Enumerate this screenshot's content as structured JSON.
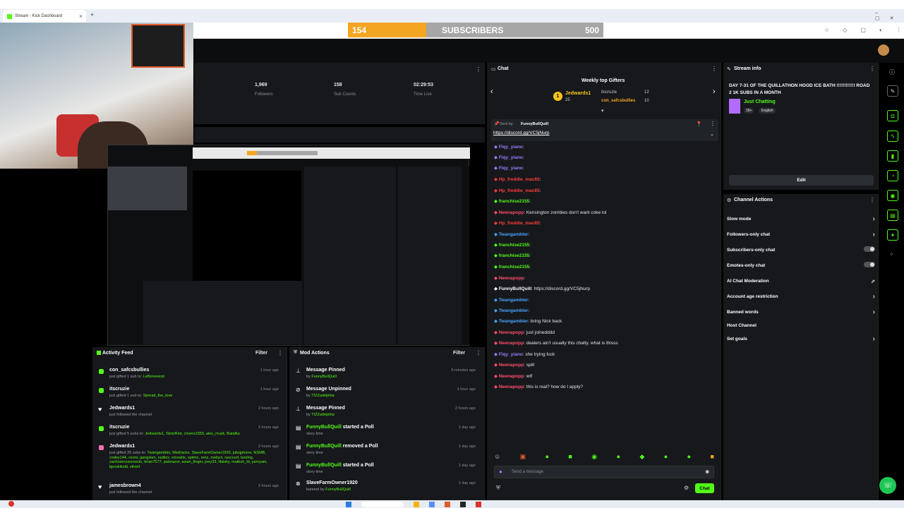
{
  "browser": {
    "tab_title": "Stream - Kick Dashboard",
    "new_tab": "+"
  },
  "subgoal": {
    "current": "154",
    "label": "SUBSCRIBERS",
    "target": "500",
    "progress": 0.308,
    "fill_color": "#f4a522"
  },
  "stats": [
    {
      "value": "1,969",
      "label": "Followers"
    },
    {
      "value": "158",
      "label": "Sub Counts"
    },
    {
      "value": "02:29:53",
      "label": "Time Live"
    }
  ],
  "activity_feed": {
    "title": "Activity Feed",
    "filter": "Filter",
    "items": [
      {
        "name": "con_safcsbullies",
        "desc": "just gifted 1 sub to:",
        "target": "LeBoneveist",
        "time": "1 hour ago",
        "icon": "gift-icon",
        "color": "#53fc18"
      },
      {
        "name": "itscruzie",
        "desc": "just gifted 1 sub to:",
        "target": "Spread_the_love",
        "time": "1 hour ago",
        "icon": "gift-icon",
        "color": "#53fc18"
      },
      {
        "name": "Jedwards1",
        "desc": "just followed the channel",
        "target": "",
        "time": "2 hours ago",
        "icon": "heart-icon",
        "color": "#ffffff"
      },
      {
        "name": "itscruzie",
        "desc": "just gifted 5 subs to:",
        "target": "Jedwards1, StotzRiot, crivers1555, ales_musk, Batalka",
        "time": "2 hours ago",
        "icon": "gift-icon",
        "color": "#53fc18"
      },
      {
        "name": "Jedwards1",
        "desc": "just gifted 25 subs to:",
        "target": "Twangambler, Mistrlackz, SlaveFarmOwner1920, jubzjphone, NSMB, codey144, vooni, gangsten, raditzs, xmxsktx, spitinc, renz, meliycl, rascourt, boolrig, zachoserusoreeclo, brian7577, pabnazor, asian_finger, joey33, lilalsky, matkuh_ld, yamyam, lgorskikold, silvert",
        "time": "2 hours ago",
        "icon": "gift-icon",
        "color": "#ff6fb5"
      },
      {
        "name": "jamesbrown4",
        "desc": "just followed the channel",
        "target": "",
        "time": "2 hours ago",
        "icon": "heart-icon",
        "color": "#ffffff"
      }
    ]
  },
  "mod_actions": {
    "title": "Mod Actions",
    "filter": "Filter",
    "items": [
      {
        "action": "Message Pinned",
        "by": "by",
        "user": "FunnyBullQuill",
        "time": "6 minutes ago",
        "icon": "pin-icon"
      },
      {
        "action": "Message Unpinned",
        "by": "by",
        "user": "TIZZadelphia",
        "time": "1 hour ago",
        "icon": "unpin-icon"
      },
      {
        "action": "Message Pinned",
        "by": "by",
        "user": "TIZZadelphia",
        "time": "2 hours ago",
        "icon": "pin-icon"
      },
      {
        "action": "FunnyBullQuill",
        "suffix": "started a Poll",
        "by": "story time",
        "user": "",
        "time": "1 day ago",
        "icon": "poll-icon"
      },
      {
        "action": "FunnyBullQuill",
        "suffix": "removed a Poll",
        "by": "story time",
        "user": "",
        "time": "1 day ago",
        "icon": "poll-icon"
      },
      {
        "action": "FunnyBullQuill",
        "suffix": "started a Poll",
        "by": "story time",
        "user": "",
        "time": "1 day ago",
        "icon": "poll-icon"
      },
      {
        "action": "SlaveFarmOwner1920",
        "suffix": "",
        "by": "banned by",
        "user": "FunnyBullQuill",
        "time": "1 day ago",
        "icon": "ban-icon"
      }
    ]
  },
  "chat": {
    "title": "Chat",
    "gifters_title": "Weekly top Gifters",
    "gifters": [
      {
        "rank": "1",
        "name": "Jedwards1",
        "count": "25"
      },
      {
        "rank": "",
        "name": "itscruzie",
        "count": "12"
      },
      {
        "rank": "",
        "name": "con_safcsbullies",
        "count": "10"
      }
    ],
    "pinned_by": "Sent by",
    "pinned_user": "FunnyBullQuill",
    "pinned_link": "https://discord.gg/VC5jNurp",
    "messages": [
      {
        "user": "Fiqy_yiano",
        "text": ":",
        "color": "#9b7cff"
      },
      {
        "user": "Fiqy_yiano",
        "text": ":",
        "color": "#9b7cff"
      },
      {
        "user": "Fiqy_yiano",
        "text": ":",
        "color": "#9b7cff"
      },
      {
        "user": "Hp_freddie_mac85",
        "text": ":",
        "color": "#ff3b3b"
      },
      {
        "user": "Hp_freddie_mac85",
        "text": ":",
        "color": "#ff3b3b"
      },
      {
        "user": "franchise2155",
        "text": ":",
        "color": "#53fc18"
      },
      {
        "user": "Neenapopp",
        "text": ": Kensington zombies don't want coke lol",
        "color": "#ff4d6d"
      },
      {
        "user": "Hp_freddie_mac85",
        "text": ":",
        "color": "#ff3b3b"
      },
      {
        "user": "Twangambler",
        "text": ":",
        "color": "#4aa3ff"
      },
      {
        "user": "franchise2155",
        "text": ":",
        "color": "#53fc18"
      },
      {
        "user": "franchise2155",
        "text": ":",
        "color": "#53fc18"
      },
      {
        "user": "franchise2155",
        "text": ":",
        "color": "#53fc18"
      },
      {
        "user": "Neenapopp",
        "text": ":",
        "color": "#ff4d6d"
      },
      {
        "user": "FunnyBullQuill",
        "text": ": https://discord.gg/VC5jNurp",
        "color": "#ffffff"
      },
      {
        "user": "Twangambler",
        "text": ":",
        "color": "#4aa3ff"
      },
      {
        "user": "Twangambler",
        "text": ":",
        "color": "#4aa3ff"
      },
      {
        "user": "Twangambler",
        "text": ": bring Nick back",
        "color": "#4aa3ff"
      },
      {
        "user": "Neenapopp",
        "text": ": just joinedddd",
        "color": "#ff4d6d"
      },
      {
        "user": "Neenapopp",
        "text": ": dealers ain't usually this chatty. what is thisss",
        "color": "#ff4d6d"
      },
      {
        "user": "Fiqy_yiano",
        "text": ": she trying fuck",
        "color": "#9b7cff"
      },
      {
        "user": "Neenapopp",
        "text": ": spill",
        "color": "#ff4d6d"
      },
      {
        "user": "Neenapopp",
        "text": ": wtf",
        "color": "#ff4d6d"
      },
      {
        "user": "Neenapopp",
        "text": ": this is real? how do I apply?",
        "color": "#ff4d6d"
      }
    ],
    "input_placeholder": "Send a message",
    "send_label": "Chat"
  },
  "stream_info": {
    "title": "Stream info",
    "stream_title": "DAY 7-31 OF THE QUILLATHON HOOD ICE BATH !!!!!!!!!!!! ROAD 2 1K SUBS IN A MONTH",
    "category": "Just Chatting",
    "tags": [
      "18+",
      "English"
    ],
    "edit_label": "Edit"
  },
  "channel_actions": {
    "title": "Channel Actions",
    "items": [
      {
        "label": "Slow mode",
        "control": "chevron"
      },
      {
        "label": "Followers-only chat",
        "control": "chevron"
      },
      {
        "label": "Subscribers-only chat",
        "control": "toggle"
      },
      {
        "label": "Emotes-only chat",
        "control": "toggle"
      },
      {
        "label": "AI Chat Moderation",
        "control": "external"
      },
      {
        "label": "Account age restriction",
        "control": "chevron"
      },
      {
        "label": "Banned words",
        "control": "chevron"
      },
      {
        "label": "Host Channel",
        "control": "none"
      },
      {
        "label": "Set goals",
        "control": "chevron"
      }
    ]
  },
  "colors": {
    "kick_green": "#53fc18",
    "panel_bg": "#16181b"
  }
}
